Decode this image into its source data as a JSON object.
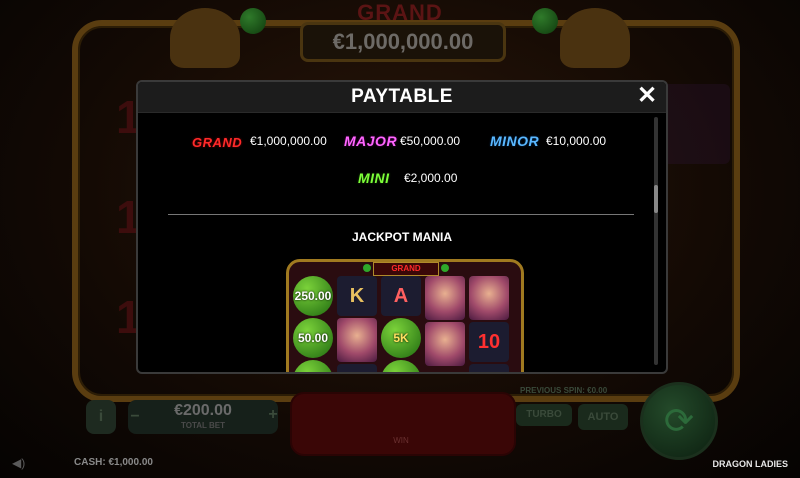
{
  "background": {
    "grand_label": "GRAND",
    "grand_value": "€1,000,000.00",
    "bet_value": "€200.00",
    "bet_label": "TOTAL BET",
    "info_label": "i",
    "minus_label": "−",
    "plus_label": "+",
    "win_label": "WIN",
    "previous_spin_label": "PREVIOUS SPIN: €0.00",
    "turbo_label": "TURBO",
    "auto_label": "AUTO",
    "cash_label": "CASH:",
    "cash_value": "€1,000.00",
    "game_title": "DRAGON LADIES",
    "spin_icon": "refresh-arrows-icon",
    "sound_icon": "speaker-icon"
  },
  "modal": {
    "title": "PAYTABLE",
    "close_label": "✕",
    "jackpots": {
      "grand": {
        "label": "GRAND",
        "value": "€1,000,000.00",
        "color": "#ff2a2a"
      },
      "major": {
        "label": "MAJOR",
        "value": "€50,000.00",
        "color": "#ff66ff"
      },
      "minor": {
        "label": "MINOR",
        "value": "€10,000.00",
        "color": "#5ab8ff"
      },
      "mini": {
        "label": "MINI",
        "value": "€2,000.00",
        "color": "#7dff3a"
      }
    },
    "section_title": "JACKPOT MANIA",
    "preview": {
      "grand_label": "GRAND",
      "ball_1": "250.00",
      "ball_2": "50.00",
      "sym_k": "K",
      "sym_a": "A",
      "ball_5k": "5K",
      "sym_10": "10"
    }
  }
}
